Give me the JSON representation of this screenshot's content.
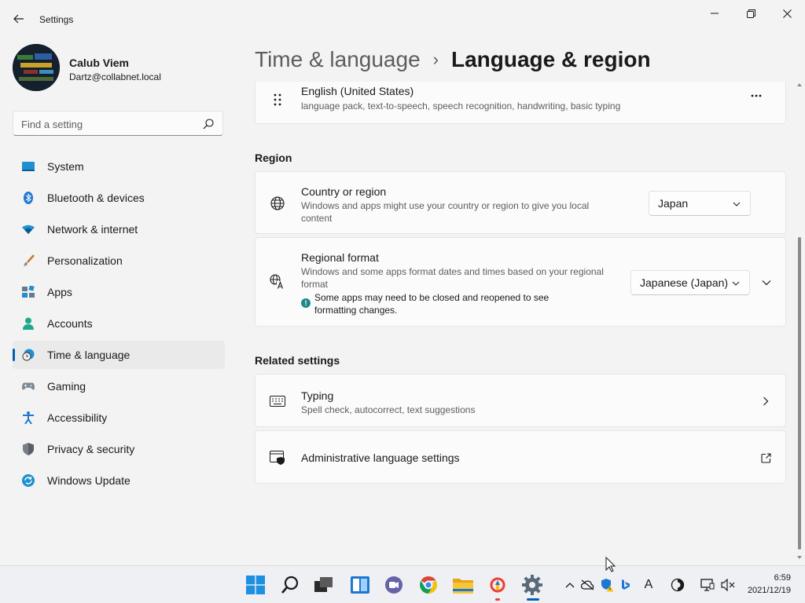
{
  "window": {
    "title": "Settings",
    "back_icon": "back-arrow-icon",
    "controls": [
      "minimize-icon",
      "maximize-icon",
      "close-icon"
    ]
  },
  "profile": {
    "name": "Calub Viem",
    "email": "Dartz@collabnet.local"
  },
  "search": {
    "placeholder": "Find a setting",
    "icon": "search-icon"
  },
  "sidebar": {
    "items": [
      {
        "label": "System",
        "icon": "system-monitor-icon",
        "active": false
      },
      {
        "label": "Bluetooth & devices",
        "icon": "bluetooth-icon",
        "active": false
      },
      {
        "label": "Network & internet",
        "icon": "wifi-icon",
        "active": false
      },
      {
        "label": "Personalization",
        "icon": "paintbrush-icon",
        "active": false
      },
      {
        "label": "Apps",
        "icon": "apps-icon",
        "active": false
      },
      {
        "label": "Accounts",
        "icon": "person-icon",
        "active": false
      },
      {
        "label": "Time & language",
        "icon": "clock-globe-icon",
        "active": true
      },
      {
        "label": "Gaming",
        "icon": "gamepad-icon",
        "active": false
      },
      {
        "label": "Accessibility",
        "icon": "accessibility-icon",
        "active": false
      },
      {
        "label": "Privacy & security",
        "icon": "shield-icon",
        "active": false
      },
      {
        "label": "Windows Update",
        "icon": "sync-icon",
        "active": false
      }
    ]
  },
  "breadcrumb": {
    "parent": "Time & language",
    "separator": "›",
    "current": "Language & region"
  },
  "language_card": {
    "title": "English (United States)",
    "description": "language pack, text-to-speech, speech recognition, handwriting, basic typing",
    "icon": "drag-handle-icon",
    "more_icon": "more-options-icon"
  },
  "region": {
    "heading": "Region",
    "country": {
      "title": "Country or region",
      "description": "Windows and apps might use your country or region to give you local content",
      "value": "Japan",
      "icon": "globe-icon"
    },
    "format": {
      "title": "Regional format",
      "description": "Windows and some apps format dates and times based on your regional format",
      "info": "Some apps may need to be closed and reopened to see formatting changes.",
      "info_glyph": "!",
      "value": "Japanese (Japan)",
      "icon": "regional-format-icon"
    }
  },
  "related": {
    "heading": "Related settings",
    "typing": {
      "title": "Typing",
      "description": "Spell check, autocorrect, text suggestions",
      "icon": "keyboard-icon"
    },
    "admin": {
      "title": "Administrative language settings",
      "icon": "admin-language-icon",
      "action_icon": "open-external-icon"
    }
  },
  "taskbar": {
    "apps": [
      "windows-start-icon",
      "search-icon",
      "task-view-icon",
      "widgets-icon",
      "teams-chat-icon",
      "chrome-icon",
      "file-explorer-icon",
      "app-icon",
      "settings-gear-icon"
    ],
    "tray": [
      "chevron-up-icon",
      "onedrive-offline-icon",
      "security-warning-icon",
      "bing-icon",
      "input-indicator-icon",
      "focus-icon",
      "network-icon",
      "volume-muted-icon"
    ],
    "input_indicator": "A",
    "time": "6:59",
    "date": "2021/12/19"
  },
  "colors": {
    "accent": "#005fb8",
    "background": "#f3f3f3",
    "card": "#fbfbfb",
    "info": "#1e8a8a"
  }
}
